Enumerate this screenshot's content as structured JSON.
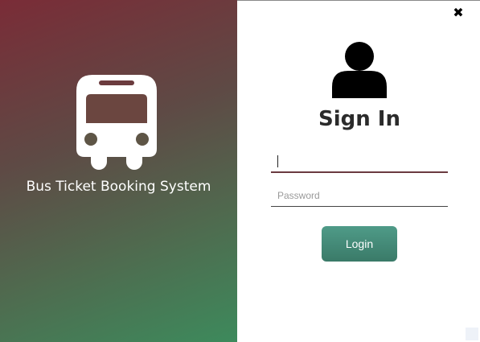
{
  "branding": {
    "app_title": "Bus Ticket Booking System",
    "logo_icon": "bus-icon"
  },
  "window": {
    "close_label": "✖"
  },
  "login_form": {
    "heading": "Sign In",
    "avatar_icon": "user-icon",
    "username": {
      "value": "",
      "placeholder": ""
    },
    "password": {
      "value": "",
      "placeholder": "Password"
    },
    "login_label": "Login"
  },
  "colors": {
    "gradient_top": "#7a2c37",
    "gradient_bottom": "#3d8a5c",
    "button": "#448a77",
    "username_underline": "#6a3a40"
  }
}
